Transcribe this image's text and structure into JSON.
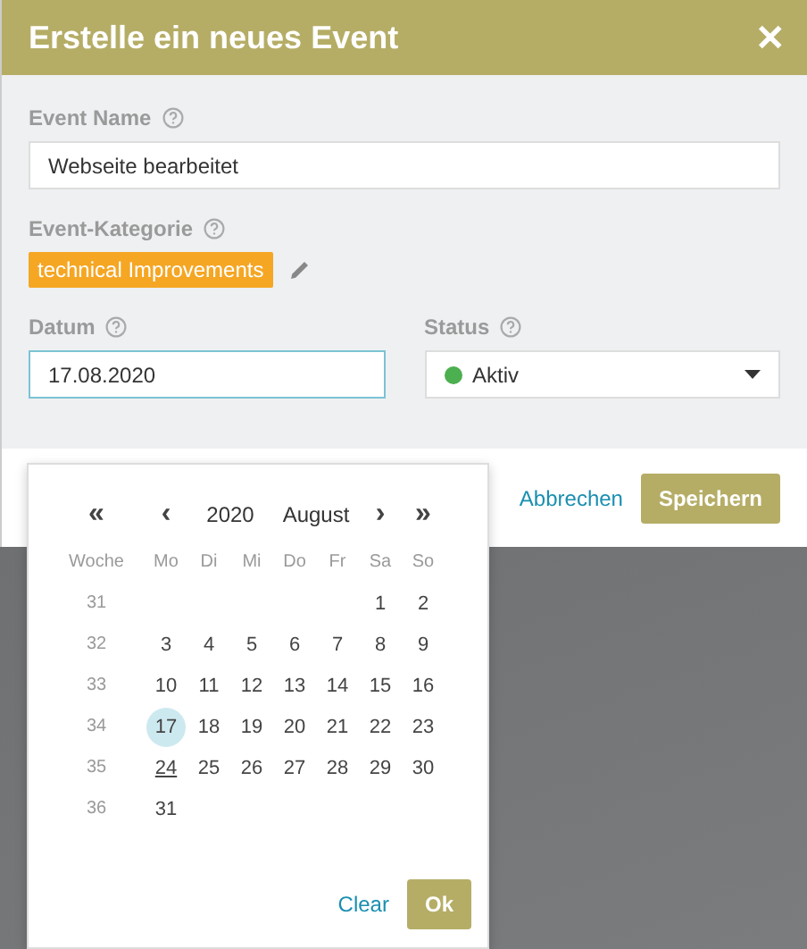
{
  "dialog": {
    "title": "Erstelle ein neues Event",
    "close": "✕"
  },
  "fields": {
    "event_name": {
      "label": "Event Name",
      "value": "Webseite bearbeitet"
    },
    "category": {
      "label": "Event-Kategorie",
      "tag": "technical Improvements",
      "color": "#f5a623"
    },
    "date": {
      "label": "Datum",
      "value": "17.08.2020",
      "focused": true
    },
    "status": {
      "label": "Status",
      "value": "Aktiv",
      "color": "#4caf50"
    }
  },
  "footer": {
    "cancel": "Abbrechen",
    "save": "Speichern"
  },
  "datepicker": {
    "prev_year": "«",
    "prev_month": "‹",
    "year": "2020",
    "month": "August",
    "next_month": "›",
    "next_year": "»",
    "week_header": "Woche",
    "weekdays": [
      "Mo",
      "Di",
      "Mi",
      "Do",
      "Fr",
      "Sa",
      "So"
    ],
    "weeks": [
      {
        "week": "31",
        "days": [
          {
            "label": "1",
            "selected": false,
            "today": false
          },
          {
            "label": "2",
            "selected": false,
            "today": false
          }
        ]
      },
      {
        "week": "32",
        "days": [
          {
            "label": "3",
            "selected": false,
            "today": false
          },
          {
            "label": "4",
            "selected": false,
            "today": false
          },
          {
            "label": "5",
            "selected": false,
            "today": false
          },
          {
            "label": "6",
            "selected": false,
            "today": false
          },
          {
            "label": "7",
            "selected": false,
            "today": false
          },
          {
            "label": "8",
            "selected": false,
            "today": false
          },
          {
            "label": "9",
            "selected": false,
            "today": false
          }
        ]
      },
      {
        "week": "33",
        "days": [
          {
            "label": "10",
            "selected": false,
            "today": false
          },
          {
            "label": "11",
            "selected": false,
            "today": false
          },
          {
            "label": "12",
            "selected": false,
            "today": false
          },
          {
            "label": "13",
            "selected": false,
            "today": false
          },
          {
            "label": "14",
            "selected": false,
            "today": false
          },
          {
            "label": "15",
            "selected": false,
            "today": false
          },
          {
            "label": "16",
            "selected": false,
            "today": false
          }
        ]
      },
      {
        "week": "34",
        "days": [
          {
            "label": "17",
            "selected": true,
            "today": false
          },
          {
            "label": "18",
            "selected": false,
            "today": false
          },
          {
            "label": "19",
            "selected": false,
            "today": false
          },
          {
            "label": "20",
            "selected": false,
            "today": false
          },
          {
            "label": "21",
            "selected": false,
            "today": false
          },
          {
            "label": "22",
            "selected": false,
            "today": false
          },
          {
            "label": "23",
            "selected": false,
            "today": false
          }
        ]
      },
      {
        "week": "35",
        "days": [
          {
            "label": "24",
            "selected": false,
            "today": true
          },
          {
            "label": "25",
            "selected": false,
            "today": false
          },
          {
            "label": "26",
            "selected": false,
            "today": false
          },
          {
            "label": "27",
            "selected": false,
            "today": false
          },
          {
            "label": "28",
            "selected": false,
            "today": false
          },
          {
            "label": "29",
            "selected": false,
            "today": false
          },
          {
            "label": "30",
            "selected": false,
            "today": false
          }
        ]
      },
      {
        "week": "36",
        "days": [
          {
            "label": "31",
            "selected": false,
            "today": false
          }
        ]
      }
    ],
    "clear": "Clear",
    "ok": "Ok"
  }
}
